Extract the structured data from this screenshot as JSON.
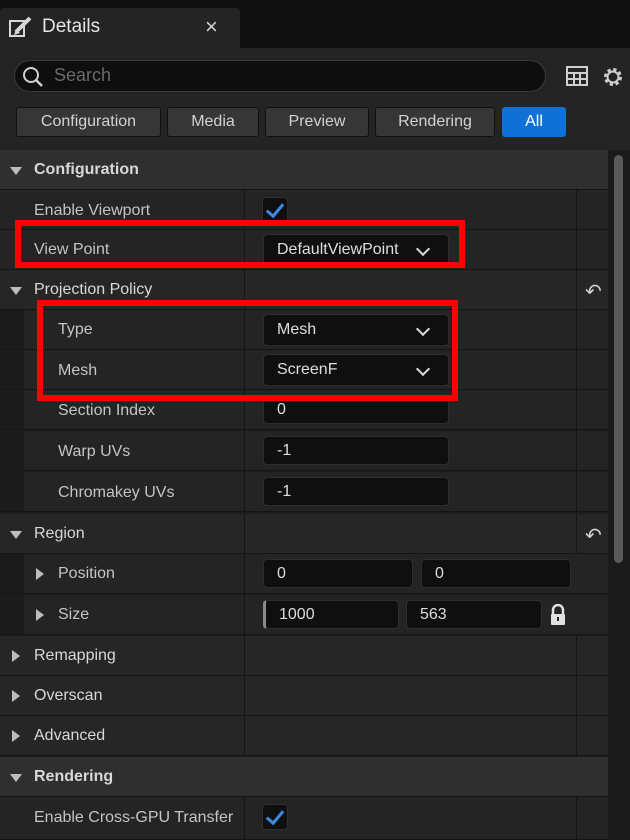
{
  "panel": {
    "title": "Details",
    "close_glyph": "×",
    "edit_icon": "pencil-icon"
  },
  "search": {
    "placeholder": "Search"
  },
  "filters": [
    "Configuration",
    "Media",
    "Preview",
    "Rendering",
    "All"
  ],
  "active_filter": "All",
  "rows": {
    "configuration": {
      "label": "Configuration"
    },
    "enable_viewport": {
      "label": "Enable Viewport",
      "checked": true
    },
    "view_point": {
      "label": "View Point",
      "value": "DefaultViewPoint"
    },
    "projection_policy": {
      "label": "Projection Policy"
    },
    "type": {
      "label": "Type",
      "value": "Mesh"
    },
    "mesh": {
      "label": "Mesh",
      "value": "ScreenF"
    },
    "section_index": {
      "label": "Section Index",
      "value": "0"
    },
    "warp_uvs": {
      "label": "Warp UVs",
      "value": "-1"
    },
    "chromakey_uvs": {
      "label": "Chromakey UVs",
      "value": "-1"
    },
    "region": {
      "label": "Region"
    },
    "position": {
      "label": "Position",
      "x": "0",
      "y": "0"
    },
    "size": {
      "label": "Size",
      "w": "1000",
      "h": "563"
    },
    "remapping": {
      "label": "Remapping"
    },
    "overscan": {
      "label": "Overscan"
    },
    "advanced": {
      "label": "Advanced"
    },
    "rendering": {
      "label": "Rendering"
    },
    "cross_gpu": {
      "label": "Enable Cross-GPU Transfer",
      "checked": true
    }
  },
  "reset_glyph": "↶",
  "colors": {
    "accent": "#0f70d6",
    "highlight": "#ff0000",
    "check": "#3c8ae6"
  }
}
